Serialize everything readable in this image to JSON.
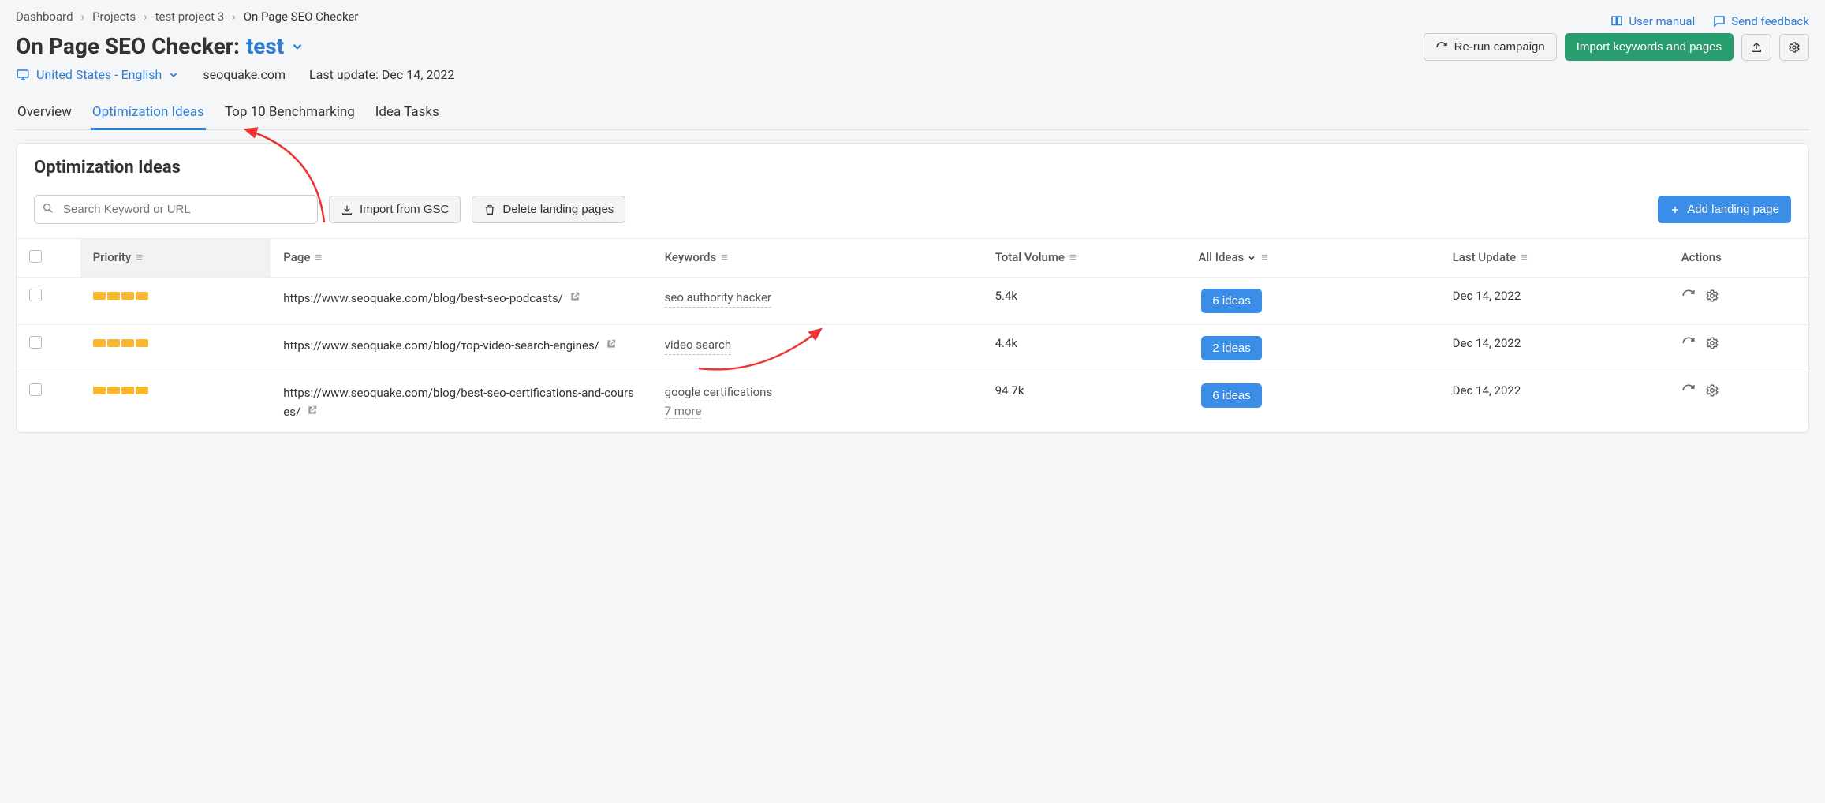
{
  "breadcrumb": {
    "items": [
      "Dashboard",
      "Projects",
      "test project 3",
      "On Page SEO Checker"
    ]
  },
  "topLinks": {
    "manual": "User manual",
    "feedback": "Send feedback"
  },
  "title": {
    "prefix": "On Page SEO Checker:",
    "project": "test"
  },
  "meta": {
    "locale": "United States - English",
    "domain": "seoquake.com",
    "lastUpdate": "Last update: Dec 14, 2022"
  },
  "actions": {
    "rerun": "Re-run campaign",
    "import": "Import keywords and pages"
  },
  "tabs": {
    "items": [
      "Overview",
      "Optimization Ideas",
      "Top 10 Benchmarking",
      "Idea Tasks"
    ],
    "activeIndex": 1
  },
  "panel": {
    "title": "Optimization Ideas",
    "searchPlaceholder": "Search Keyword or URL",
    "importGsc": "Import from GSC",
    "deletePages": "Delete landing pages",
    "addPage": "Add landing page"
  },
  "table": {
    "headers": {
      "priority": "Priority",
      "page": "Page",
      "keywords": "Keywords",
      "volume": "Total Volume",
      "ideas": "All Ideas",
      "lastUpdate": "Last Update",
      "actions": "Actions"
    },
    "rows": [
      {
        "priority": 4,
        "url": "https://www.seoquake.com/blog/best-seo-podcasts/",
        "keywords": "seo authority hacker",
        "more": "",
        "volume": "5.4k",
        "ideas": "6 ideas",
        "lastUpdate": "Dec 14, 2022"
      },
      {
        "priority": 4,
        "url": "https://www.seoquake.com/blog/тор-video-search-engines/",
        "keywords": "video search",
        "more": "",
        "volume": "4.4k",
        "ideas": "2 ideas",
        "lastUpdate": "Dec 14, 2022"
      },
      {
        "priority": 4,
        "url": "https://www.seoquake.com/blog/best-seo-certifications-and-courses/",
        "keywords": "google certifications",
        "more": "7 more",
        "volume": "94.7k",
        "ideas": "6 ideas",
        "lastUpdate": "Dec 14, 2022"
      }
    ]
  }
}
